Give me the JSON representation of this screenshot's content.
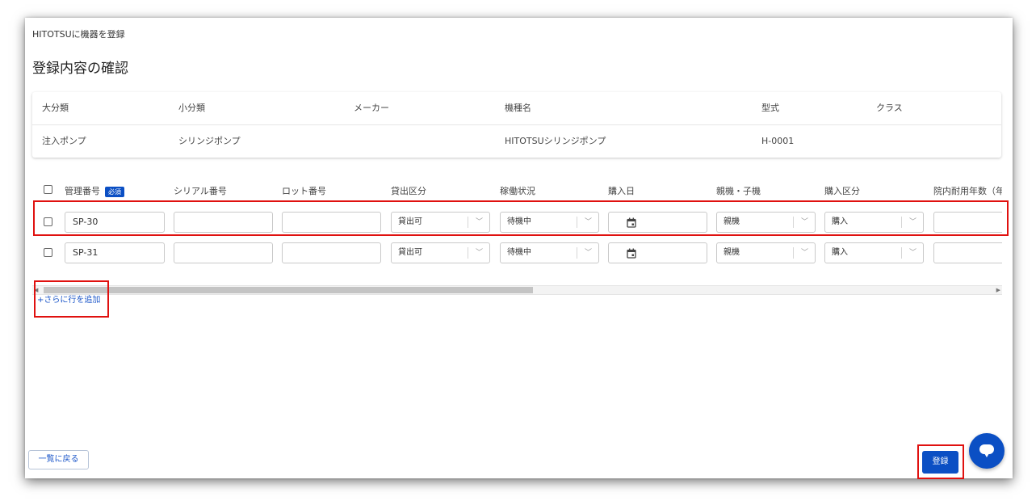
{
  "breadcrumb": "HITOTSUに機器を登録",
  "page_title": "登録内容の確認",
  "info_table": {
    "headers": [
      "大分類",
      "小分類",
      "メーカー",
      "機種名",
      "型式",
      "クラス"
    ],
    "values": [
      "注入ポンプ",
      "シリンジポンプ",
      "",
      "HITOTSUシリンジポンプ",
      "H-0001",
      ""
    ]
  },
  "device_table": {
    "headers": {
      "mgmt_no": "管理番号",
      "required_badge": "必須",
      "serial_no": "シリアル番号",
      "lot_no": "ロット番号",
      "rental_class": "貸出区分",
      "operation_status": "稼働状況",
      "purchase_date": "購入日",
      "parent_child": "親機・子機",
      "purchase_class": "購入区分",
      "useful_life": "院内耐用年数（年）"
    },
    "rows": [
      {
        "mgmt_no": "SP-30",
        "serial_no": "",
        "lot_no": "",
        "rental_class": "貸出可",
        "operation_status": "待機中",
        "purchase_date": "",
        "parent_child": "親機",
        "purchase_class": "購入",
        "useful_life": ""
      },
      {
        "mgmt_no": "SP-31",
        "serial_no": "",
        "lot_no": "",
        "rental_class": "貸出可",
        "operation_status": "待機中",
        "purchase_date": "",
        "parent_child": "親機",
        "purchase_class": "購入",
        "useful_life": ""
      }
    ]
  },
  "add_row_label": "+さらに行を追加",
  "back_button": "一覧に戻る",
  "submit_button": "登録",
  "icons": {
    "checkbox": "checkbox-icon",
    "calendar": "calendar-icon",
    "dropdown": "chevron-down-icon",
    "chat": "chat-icon"
  },
  "colors": {
    "primary": "#0b4fc4",
    "link": "#1a55c9",
    "highlight_border": "#e0110f"
  }
}
